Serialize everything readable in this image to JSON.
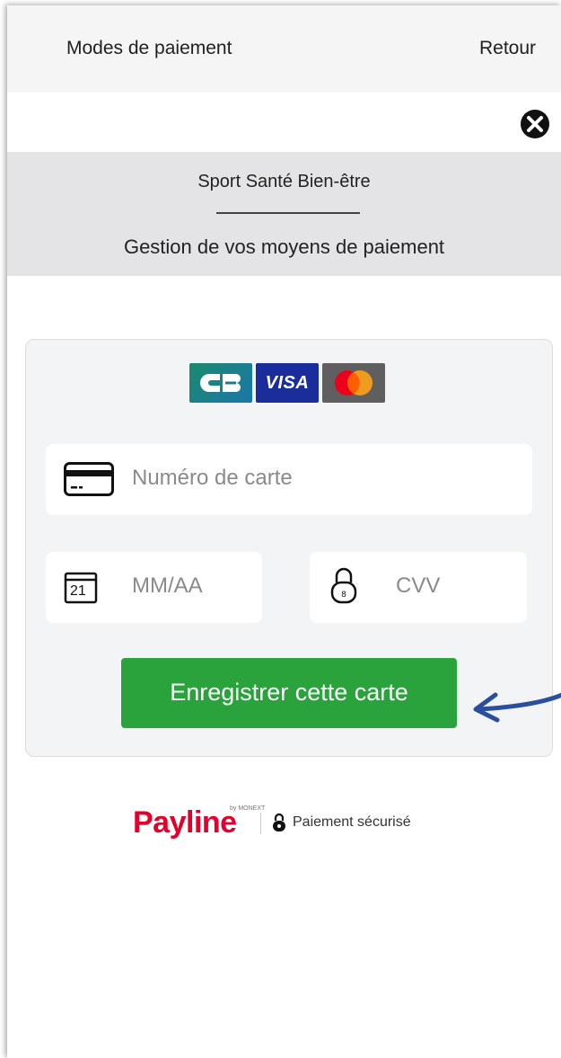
{
  "header": {
    "title": "Modes de paiement",
    "back_label": "Retour"
  },
  "banner": {
    "merchant": "Sport Santé Bien-être",
    "subtitle": "Gestion de vos moyens de paiement"
  },
  "card_form": {
    "brands": [
      "CB",
      "VISA",
      "Mastercard"
    ],
    "card_number": {
      "value": "",
      "placeholder": "Numéro de carte"
    },
    "expiry": {
      "value": "",
      "placeholder": "MM/AA",
      "calendar_day": "21"
    },
    "cvv": {
      "value": "",
      "placeholder": "CVV"
    },
    "submit_label": "Enregistrer cette carte"
  },
  "footer": {
    "provider": "Payline",
    "provider_sub": "by MONEXT",
    "secure_label": "Paiement sécurisé"
  },
  "colors": {
    "accent_green": "#2aa33d",
    "payline_red": "#e4002b",
    "annotation_arrow": "#2a4f9c"
  }
}
